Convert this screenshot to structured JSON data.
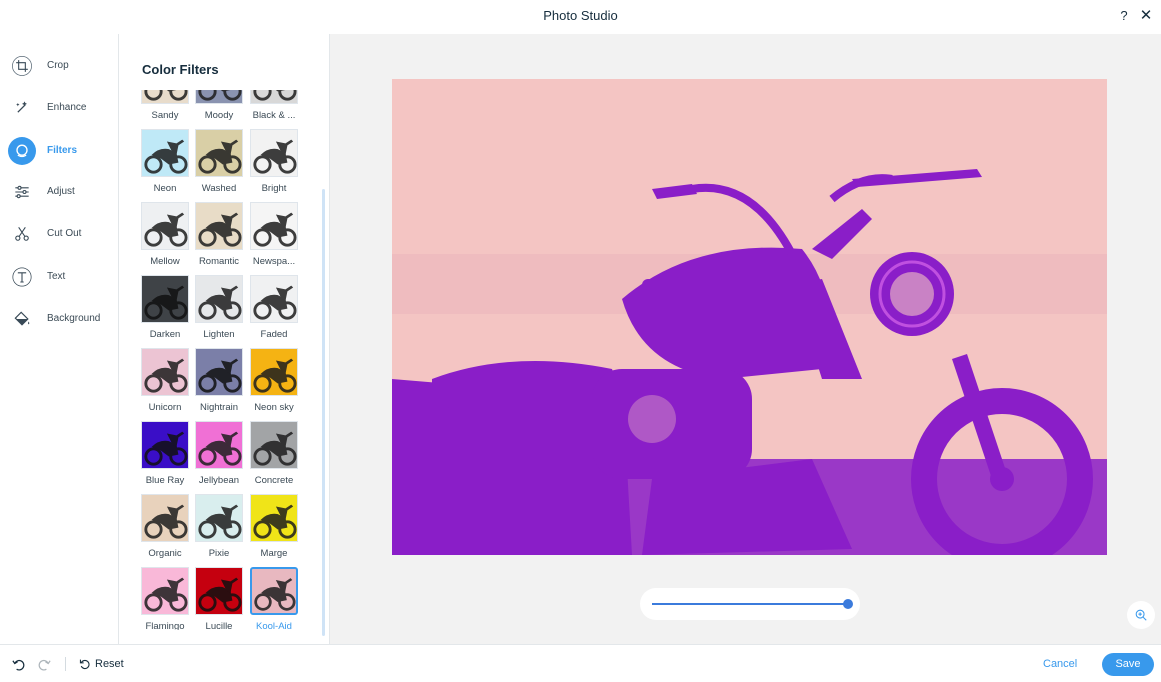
{
  "header": {
    "title": "Photo Studio",
    "help_label": "?",
    "close_label": "✕"
  },
  "tools": [
    {
      "id": "crop",
      "label": "Crop",
      "icon": "crop-icon"
    },
    {
      "id": "enhance",
      "label": "Enhance",
      "icon": "magic-wand-icon"
    },
    {
      "id": "filters",
      "label": "Filters",
      "icon": "filters-icon",
      "active": true
    },
    {
      "id": "adjust",
      "label": "Adjust",
      "icon": "sliders-icon"
    },
    {
      "id": "cutout",
      "label": "Cut Out",
      "icon": "scissors-icon"
    },
    {
      "id": "text",
      "label": "Text",
      "icon": "text-icon"
    },
    {
      "id": "background",
      "label": "Background",
      "icon": "paint-bucket-icon"
    }
  ],
  "panel": {
    "title": "Color Filters"
  },
  "filters": [
    {
      "name": "Sandy",
      "color": "#e8dccb"
    },
    {
      "name": "Moody",
      "color": "#8a93b0"
    },
    {
      "name": "Black & ...",
      "color": "#d8d8d8"
    },
    {
      "name": "Neon",
      "color": "#bfe9f7"
    },
    {
      "name": "Washed",
      "color": "#d9cfa6"
    },
    {
      "name": "Bright",
      "color": "#f2f2f2"
    },
    {
      "name": "Mellow",
      "color": "#eef0f2"
    },
    {
      "name": "Romantic",
      "color": "#e8dcc7"
    },
    {
      "name": "Newspa...",
      "color": "#f5f5f5"
    },
    {
      "name": "Darken",
      "color": "#3f4347"
    },
    {
      "name": "Lighten",
      "color": "#e6e8ea"
    },
    {
      "name": "Faded",
      "color": "#f0f1f2"
    },
    {
      "name": "Unicorn",
      "color": "#ecc4d3"
    },
    {
      "name": "Nightrain",
      "color": "#7b7fa8"
    },
    {
      "name": "Neon sky",
      "color": "#f5b313"
    },
    {
      "name": "Blue Ray",
      "color": "#3a0ec7"
    },
    {
      "name": "Jellybean",
      "color": "#f070d5"
    },
    {
      "name": "Concrete",
      "color": "#a2a4a6"
    },
    {
      "name": "Organic",
      "color": "#e8d2bc"
    },
    {
      "name": "Pixie",
      "color": "#d9eeee"
    },
    {
      "name": "Marge",
      "color": "#f0e418"
    },
    {
      "name": "Flamingo",
      "color": "#f9b8d8"
    },
    {
      "name": "Lucille",
      "color": "#c5000f"
    },
    {
      "name": "Kool-Aid",
      "color": "#e8b8c0",
      "selected": true
    }
  ],
  "colors": {
    "accent": "#3899ec",
    "preview_bg": "#f4c5c3",
    "preview_ink": "#8a1ec8"
  },
  "slider": {
    "value": 100
  },
  "footer": {
    "reset_label": "Reset",
    "cancel_label": "Cancel",
    "save_label": "Save"
  }
}
